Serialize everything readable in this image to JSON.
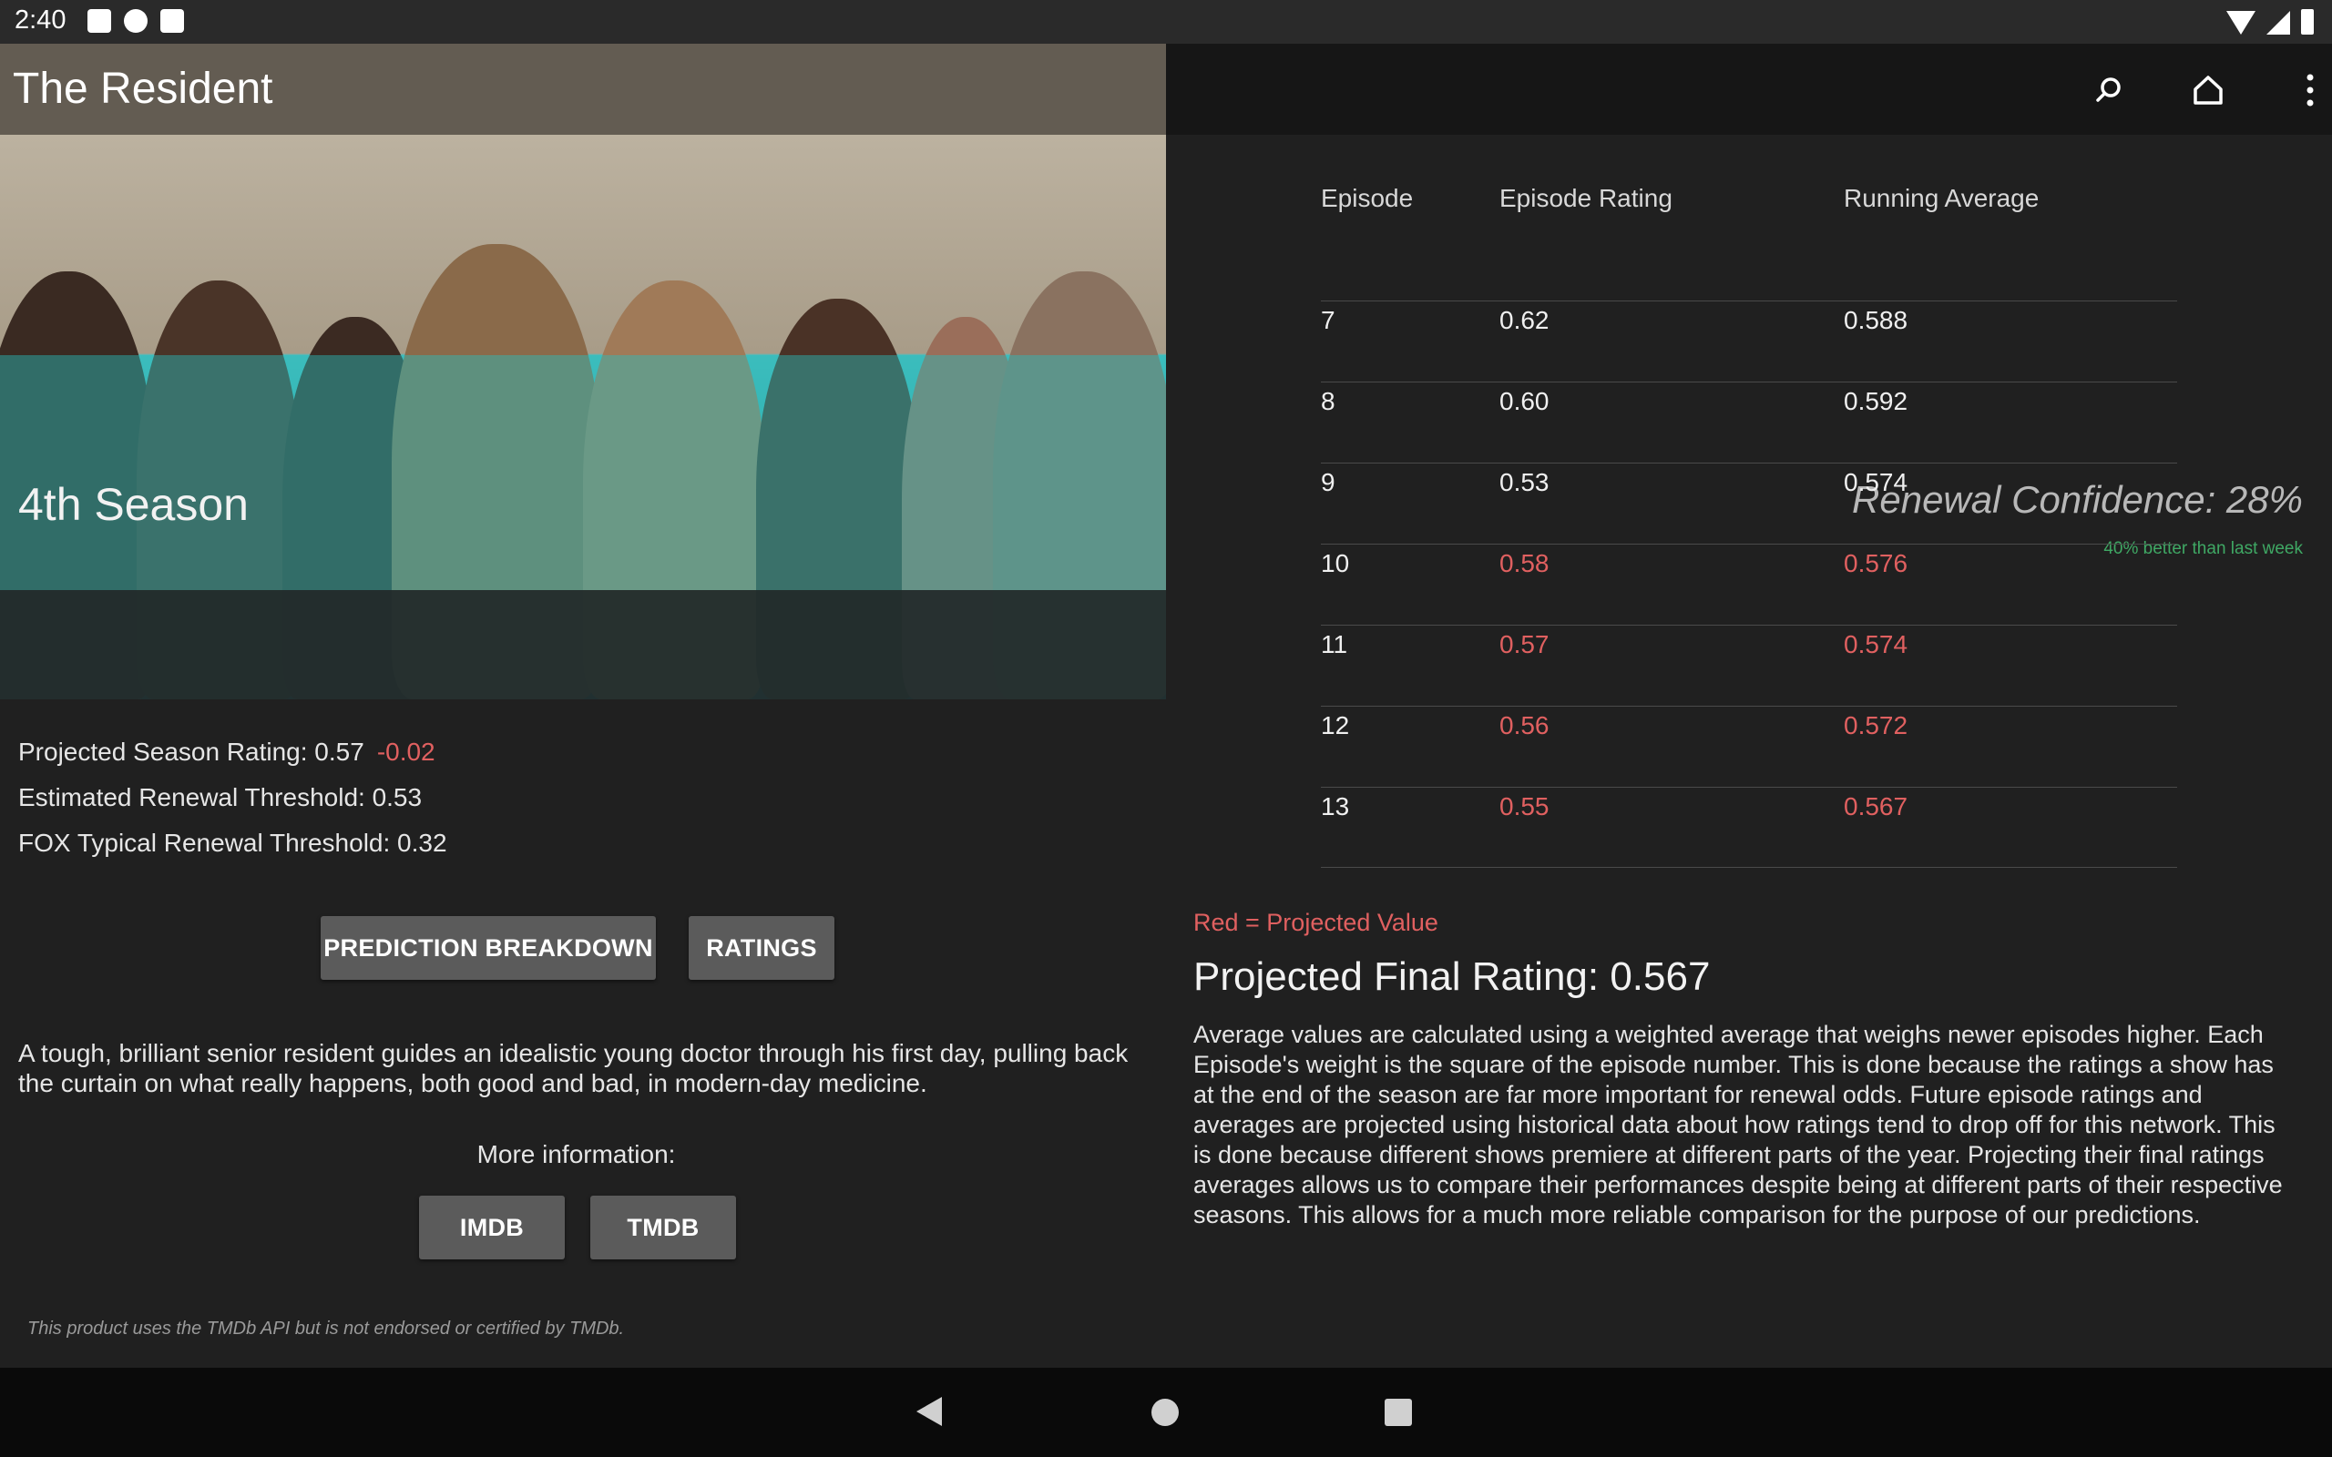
{
  "status_bar": {
    "time": "2:40"
  },
  "app_bar": {
    "title": "The Resident",
    "actions": [
      "search-icon",
      "home-icon",
      "more-vert-icon"
    ]
  },
  "season": {
    "title": "4th Season",
    "renewal_confidence": "Renewal Confidence: 28%",
    "trend": "40% better than last week"
  },
  "stats": {
    "projected_label": "Projected Season Rating: 0.57",
    "projected_delta": "-0.02",
    "estimated_threshold": "Estimated Renewal Threshold: 0.53",
    "network_threshold": "FOX Typical Renewal Threshold: 0.32"
  },
  "buttons": {
    "prediction_breakdown": "PREDICTION BREAKDOWN",
    "ratings": "RATINGS",
    "imdb": "IMDB",
    "tmdb": "TMDB"
  },
  "description": "A tough, brilliant senior resident guides an idealistic young doctor through his first day, pulling back the curtain on what really happens, both good and bad, in modern-day medicine.",
  "more_info_label": "More information:",
  "disclaimer": "This product uses the TMDb API but is not endorsed or certified by TMDb.",
  "table": {
    "headers": [
      "Episode",
      "Episode Rating",
      "Running Average"
    ],
    "rows": [
      {
        "episode": "7",
        "rating": "0.62",
        "average": "0.588",
        "projected": false
      },
      {
        "episode": "8",
        "rating": "0.60",
        "average": "0.592",
        "projected": false
      },
      {
        "episode": "9",
        "rating": "0.53",
        "average": "0.574",
        "projected": false
      },
      {
        "episode": "10",
        "rating": "0.58",
        "average": "0.576",
        "projected": true
      },
      {
        "episode": "11",
        "rating": "0.57",
        "average": "0.574",
        "projected": true
      },
      {
        "episode": "12",
        "rating": "0.56",
        "average": "0.572",
        "projected": true
      },
      {
        "episode": "13",
        "rating": "0.55",
        "average": "0.567",
        "projected": true
      }
    ]
  },
  "legend": "Red = Projected Value",
  "projected_final": "Projected Final Rating: 0.567",
  "explanation": "Average values are calculated using a weighted average that weighs newer episodes higher. Each Episode's weight is the square of the episode number. This is done because the ratings a show has at the end of the season are far more important for renewal odds. Future episode ratings and averages are projected using historical data about how ratings tend to drop off for this network. This is done because different shows premiere at different parts of the year. Projecting their final ratings averages allows us to compare their performances despite being at different parts of their respective seasons. This allows for a much more reliable comparison for the purpose of our predictions.",
  "colors": {
    "projected_red": "#e06060",
    "trend_green": "#3fa864",
    "app_bar_left": "#635c52",
    "button_bg": "#5b5b5b"
  }
}
